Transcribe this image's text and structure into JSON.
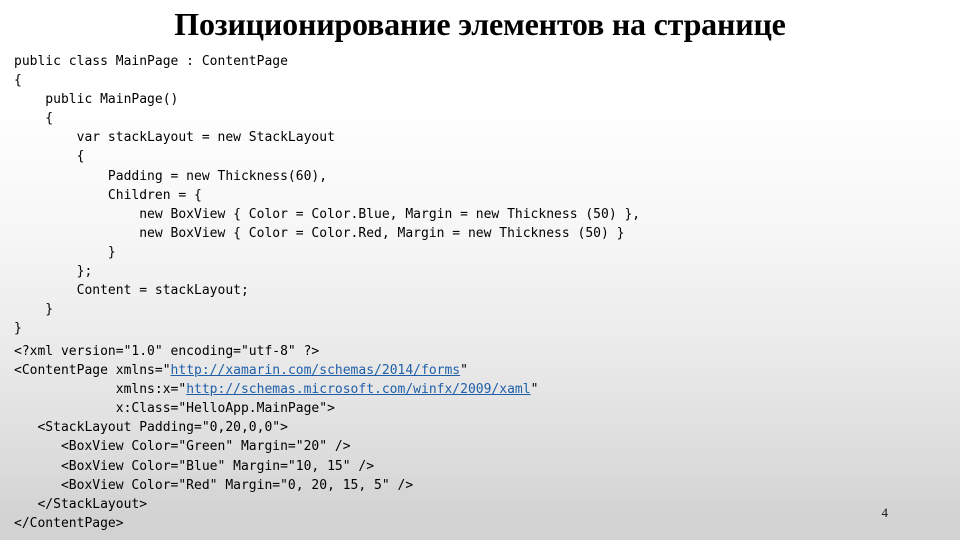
{
  "slide": {
    "title": "Позиционирование элементов на странице",
    "number": "4",
    "link_color": "#1f5fa9",
    "text_color": "#000000"
  },
  "csharp_code": {
    "lines": [
      {
        "segments": [
          {
            "text": "public class MainPage : ContentPage"
          }
        ]
      },
      {
        "segments": [
          {
            "text": "{"
          }
        ]
      },
      {
        "segments": [
          {
            "text": "    public MainPage()"
          }
        ]
      },
      {
        "segments": [
          {
            "text": "    {"
          }
        ]
      },
      {
        "segments": [
          {
            "text": "        var stackLayout = new StackLayout"
          }
        ]
      },
      {
        "segments": [
          {
            "text": "        {"
          }
        ]
      },
      {
        "segments": [
          {
            "text": "            Padding = new Thickness(60),"
          }
        ]
      },
      {
        "segments": [
          {
            "text": "            Children = {"
          }
        ]
      },
      {
        "segments": [
          {
            "text": "                new BoxView { Color = Color.Blue, Margin = new Thickness (50) },"
          }
        ]
      },
      {
        "segments": [
          {
            "text": "                new BoxView { Color = Color.Red, Margin = new Thickness (50) }"
          }
        ]
      },
      {
        "segments": [
          {
            "text": "            }"
          }
        ]
      },
      {
        "segments": [
          {
            "text": "        };"
          }
        ]
      },
      {
        "segments": [
          {
            "text": "        Content = stackLayout;"
          }
        ]
      },
      {
        "segments": [
          {
            "text": "    }"
          }
        ]
      },
      {
        "segments": [
          {
            "text": "}"
          }
        ]
      }
    ]
  },
  "xaml_code": {
    "lines": [
      {
        "segments": [
          {
            "text": "<?xml version=\"1.0\" encoding=\"utf-8\" ?>"
          }
        ]
      },
      {
        "segments": [
          {
            "text": "<ContentPage xmlns=\""
          },
          {
            "text": "http://xamarin.com/schemas/2014/forms",
            "link": true
          },
          {
            "text": "\""
          }
        ]
      },
      {
        "segments": [
          {
            "text": "             xmlns:x=\""
          },
          {
            "text": "http://schemas.microsoft.com/winfx/2009/xaml",
            "link": true
          },
          {
            "text": "\""
          }
        ]
      },
      {
        "segments": [
          {
            "text": "             x:Class=\"HelloApp.MainPage\">"
          }
        ]
      },
      {
        "segments": [
          {
            "text": "   <StackLayout Padding=\"0,20,0,0\">"
          }
        ]
      },
      {
        "segments": [
          {
            "text": "      <BoxView Color=\"Green\" Margin=\"20\" />"
          }
        ]
      },
      {
        "segments": [
          {
            "text": "      <BoxView Color=\"Blue\" Margin=\"10, 15\" />"
          }
        ]
      },
      {
        "segments": [
          {
            "text": "      <BoxView Color=\"Red\" Margin=\"0, 20, 15, 5\" />"
          }
        ]
      },
      {
        "segments": [
          {
            "text": "   </StackLayout>"
          }
        ]
      },
      {
        "segments": [
          {
            "text": "</ContentPage>"
          }
        ]
      }
    ]
  }
}
